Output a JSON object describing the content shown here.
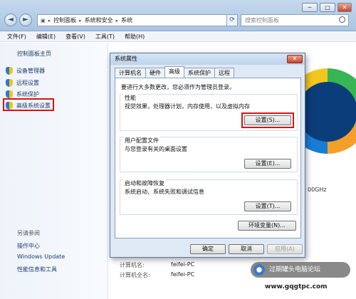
{
  "window": {
    "minimize": "─",
    "maximize": "□",
    "close": "✕",
    "back": "◄",
    "forward": "►",
    "breadcrumb": [
      "控制面板",
      "系统和安全",
      "系统"
    ],
    "search_placeholder": "搜索控制面板"
  },
  "menu": [
    "文件(F)",
    "编辑(E)",
    "查看(V)",
    "工具(T)",
    "帮助(H)"
  ],
  "sidebar": {
    "home": "控制面板主页",
    "items": [
      {
        "label": "设备管理器"
      },
      {
        "label": "远程设置"
      },
      {
        "label": "系统保护"
      },
      {
        "label": "高级系统设置"
      }
    ],
    "see_also": "另请参阅",
    "links": [
      "操作中心",
      "Windows Update",
      "性能信息和工具"
    ]
  },
  "main": {
    "cpu_speed": "00GHz",
    "computer_name_label": "计算机名:",
    "computer_name_value": "feifei-PC",
    "full_name_label": "计算机全名:",
    "full_name_value": "feifei-PC"
  },
  "dialog": {
    "title": "系统属性",
    "close": "✕",
    "tabs": [
      "计算机名",
      "硬件",
      "高级",
      "系统保护",
      "远程"
    ],
    "active_tab": "高级",
    "note": "要进行大多数更改，您必须作为管理员登录。",
    "performance": {
      "title": "性能",
      "desc": "视觉效果，处理器计划，内存使用，以及虚拟内存",
      "button": "设置(S)..."
    },
    "user_profiles": {
      "title": "用户配置文件",
      "desc": "与您登录有关的桌面设置",
      "button": "设置(E)..."
    },
    "startup_recovery": {
      "title": "启动和故障恢复",
      "desc": "系统启动、系统失败和调试信息",
      "button": "设置(T)..."
    },
    "env_button": "环境变量(N)...",
    "ok": "确定",
    "cancel": "取消",
    "apply": "应用(A)"
  },
  "watermark": {
    "text": "过期罐头电脑论坛",
    "url": "www.gqgtpc.com"
  }
}
